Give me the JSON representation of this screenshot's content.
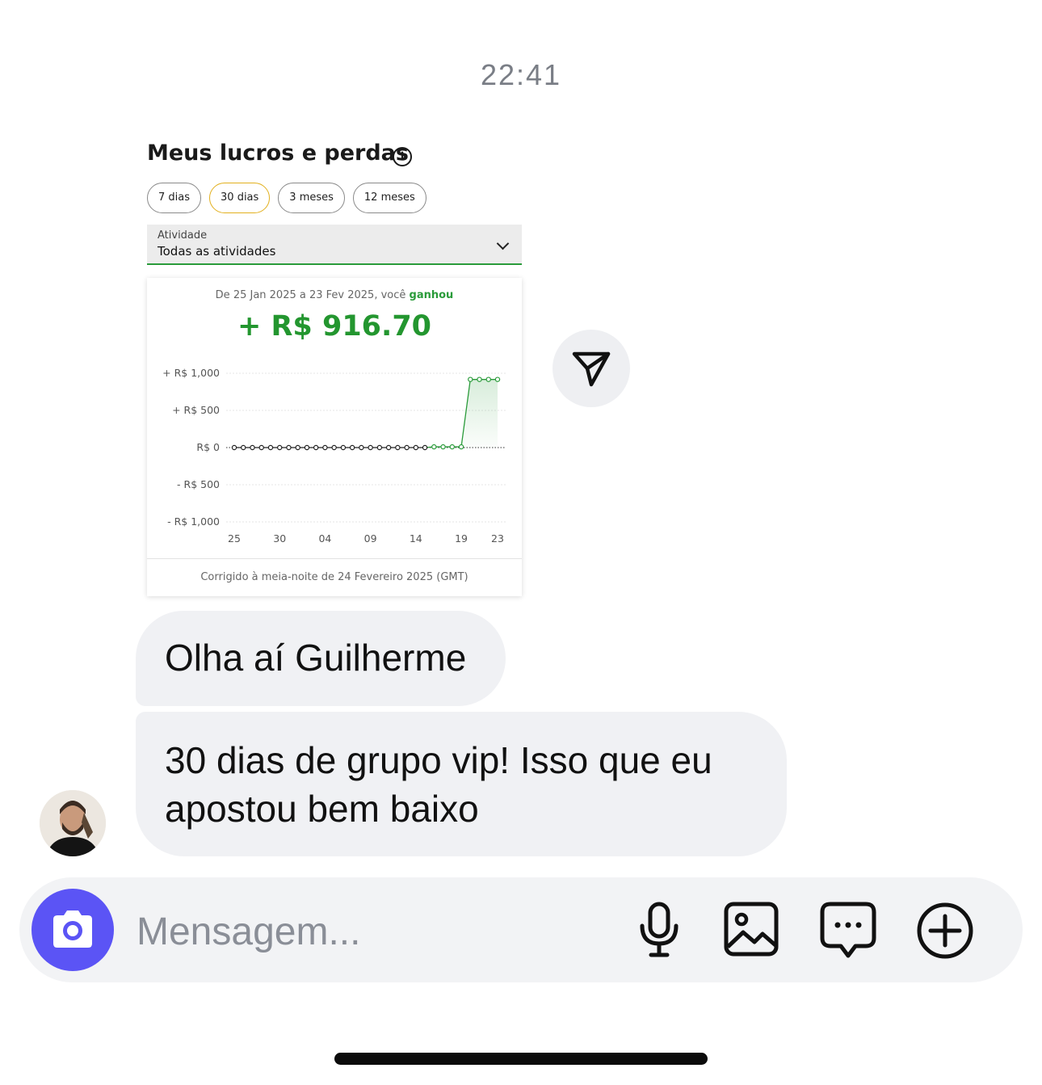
{
  "status": {
    "time": "22:41"
  },
  "shared_card": {
    "title": "Meus lucros e perdas",
    "info_icon": "info-icon",
    "pills": [
      {
        "label": "7 dias",
        "active": false
      },
      {
        "label": "30 dias",
        "active": true
      },
      {
        "label": "3 meses",
        "active": false
      },
      {
        "label": "12 meses",
        "active": false
      }
    ],
    "activity_select": {
      "label": "Atividade",
      "value": "Todas as atividades"
    },
    "summary": {
      "range_prefix": "De 25 Jan 2025 a 23 Fev 2025, você",
      "range_result": "ganhou",
      "amount": "+ R$ 916.70"
    },
    "footer": "Corrigido à meia-noite de 24 Fevereiro 2025 (GMT)"
  },
  "chart_data": {
    "type": "line",
    "x_tick_labels": [
      "25",
      "30",
      "04",
      "09",
      "14",
      "19",
      "23"
    ],
    "y_tick_labels": [
      "+ R$ 1,000",
      "+ R$ 500",
      "R$ 0",
      "- R$ 500",
      "- R$ 1,000"
    ],
    "ylim": [
      -1000,
      1000
    ],
    "x": [
      "25 Jan",
      "26 Jan",
      "27 Jan",
      "28 Jan",
      "29 Jan",
      "30 Jan",
      "31 Jan",
      "01 Fev",
      "02 Fev",
      "03 Fev",
      "04 Fev",
      "05 Fev",
      "06 Fev",
      "07 Fev",
      "08 Fev",
      "09 Fev",
      "10 Fev",
      "11 Fev",
      "12 Fev",
      "13 Fev",
      "14 Fev",
      "15 Fev",
      "16 Fev",
      "17 Fev",
      "18 Fev",
      "19 Fev",
      "20 Fev",
      "21 Fev",
      "22 Fev",
      "23 Fev"
    ],
    "values": [
      0,
      0,
      0,
      0,
      0,
      0,
      0,
      0,
      0,
      0,
      0,
      0,
      0,
      0,
      0,
      0,
      0,
      0,
      0,
      0,
      0,
      0,
      10,
      10,
      10,
      10,
      916.7,
      916.7,
      916.7,
      916.7
    ],
    "line_color": "#2a9b3a",
    "grid": true
  },
  "thread": {
    "messages": [
      {
        "text": "Olha aí Guilherme"
      },
      {
        "text": "30 dias de grupo vip! Isso que eu apostou bem baixo"
      }
    ],
    "share_icon": "send-icon"
  },
  "composer": {
    "placeholder": "Mensagem...",
    "icons": [
      "camera-icon",
      "microphone-icon",
      "image-icon",
      "chat-bubble-icon",
      "plus-circle-icon"
    ],
    "accent": "#5b54f5"
  }
}
